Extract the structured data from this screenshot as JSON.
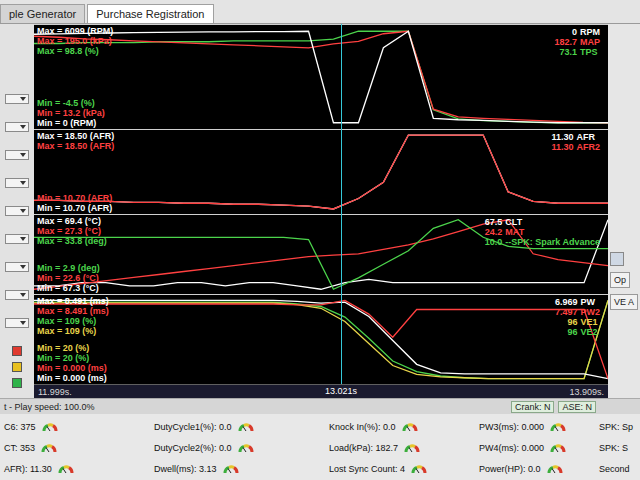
{
  "tabs": [
    {
      "label": "ple Generator",
      "selected": false
    },
    {
      "label": "Purchase Registration",
      "selected": true
    }
  ],
  "left_markers": [
    {
      "color": "#e03a2f"
    },
    {
      "color": "#e8c020"
    },
    {
      "color": "#2fb34a"
    }
  ],
  "right_buttons": [
    "Op",
    "VE A"
  ],
  "chart": {
    "start": "11.999s.",
    "cursor": "13.021s",
    "end": "13.909s.",
    "cursor_position": 0.535,
    "panels": [
      {
        "max_labels": [
          {
            "text": "Max = 6099 (RPM)",
            "color": "#ffffff"
          },
          {
            "text": "Max = 195.0 (kPa)",
            "color": "#ff4040"
          },
          {
            "text": "Max = 98.8 (%)",
            "color": "#4cd44c"
          }
        ],
        "min_labels": [
          {
            "text": "Min = -4.5 (%)",
            "color": "#4cd44c"
          },
          {
            "text": "Min = 13.2 (kPa)",
            "color": "#ff4040"
          },
          {
            "text": "Min = 0 (RPM)",
            "color": "#ffffff"
          }
        ],
        "readings": [
          {
            "value": "0",
            "name": "RPM",
            "color": "#ffffff"
          },
          {
            "value": "182.7",
            "name": "MAP",
            "color": "#ff4040"
          },
          {
            "value": "73.1",
            "name": "TPS",
            "color": "#4cd44c"
          }
        ],
        "series": [
          {
            "name": "TPS",
            "color": "#4cd44c",
            "values": [
              85,
              85,
              86,
              86,
              86,
              87,
              87,
              87,
              88,
              88,
              88,
              88,
              90,
              98.8,
              98.8,
              98.8,
              10,
              0,
              -2,
              -3,
              -4,
              -4.5,
              -4.5,
              -4.5
            ]
          },
          {
            "name": "MAP",
            "color": "#ff4040",
            "values": [
              185,
              183,
              180,
              178,
              176,
              174,
              172,
              170,
              168,
              166,
              164,
              162,
              170,
              175,
              190,
              195,
              40,
              25,
              22,
              20,
              18,
              16,
              14,
              13.2
            ]
          },
          {
            "name": "RPM",
            "color": "#ffffff",
            "values": [
              5900,
              5920,
              5950,
              5980,
              6000,
              6020,
              6040,
              6050,
              6060,
              6070,
              6080,
              6099,
              0,
              0,
              5000,
              6099,
              300,
              200,
              150,
              100,
              50,
              0,
              0,
              0
            ]
          }
        ]
      },
      {
        "max_labels": [
          {
            "text": "Max = 18.50 (AFR)",
            "color": "#ffffff"
          },
          {
            "text": "Max = 18.50 (AFR)",
            "color": "#ff4040"
          }
        ],
        "min_labels": [
          {
            "text": "Min = 10.70 (AFR)",
            "color": "#ff4040"
          },
          {
            "text": "Min = 10.70 (AFR)",
            "color": "#ffffff"
          }
        ],
        "readings": [
          {
            "value": "11.30",
            "name": "AFR",
            "color": "#ffffff"
          },
          {
            "value": "11.30",
            "name": "AFR2",
            "color": "#ff4040"
          }
        ],
        "series": [
          {
            "name": "AFR",
            "color": "#ffffff",
            "values": [
              11.6,
              11.6,
              11.5,
              11.5,
              11.4,
              11.4,
              11.3,
              11.3,
              11.2,
              11.2,
              11.1,
              11.0,
              10.7,
              11.8,
              13.5,
              18.5,
              18.5,
              18.5,
              18.5,
              12.5,
              11.5,
              11.3,
              11.3,
              11.3
            ]
          },
          {
            "name": "AFR2",
            "color": "#ff4040",
            "values": [
              11.6,
              11.6,
              11.5,
              11.5,
              11.4,
              11.4,
              11.3,
              11.3,
              11.2,
              11.2,
              11.1,
              11.0,
              10.7,
              11.8,
              13.5,
              18.5,
              18.5,
              18.5,
              18.5,
              12.5,
              11.5,
              11.3,
              11.3,
              11.3
            ]
          }
        ]
      },
      {
        "max_labels": [
          {
            "text": "Max = 69.4 (°C)",
            "color": "#ffffff"
          },
          {
            "text": "Max = 27.3 (°C)",
            "color": "#ff4040"
          },
          {
            "text": "Max = 33.8 (deg)",
            "color": "#4cd44c"
          }
        ],
        "min_labels": [
          {
            "text": "Min = 2.9 (deg)",
            "color": "#4cd44c"
          },
          {
            "text": "Min = 22.6 (°C)",
            "color": "#ff4040"
          },
          {
            "text": "Min = 67.3 (°C)",
            "color": "#ffffff"
          }
        ],
        "readings": [
          {
            "value": "67.5",
            "name": "CLT",
            "color": "#ffffff"
          },
          {
            "value": "24.2",
            "name": "MAT",
            "color": "#ff4040"
          },
          {
            "value": "10.0",
            "name": "--SPK: Spark Advance",
            "color": "#4cd44c"
          }
        ],
        "series": [
          {
            "name": "CLT",
            "color": "#ffffff",
            "values": [
              67.4,
              67.4,
              67.5,
              67.5,
              67.4,
              67.4,
              67.5,
              67.5,
              67.4,
              67.5,
              67.5,
              67.4,
              67.3,
              67.5,
              67.6,
              67.5,
              67.5,
              67.5,
              67.5,
              67.5,
              67.5,
              67.5,
              67.5,
              67.5,
              69.4
            ]
          },
          {
            "name": "MAT",
            "color": "#ff4040",
            "values": [
              22.6,
              22.8,
              23.0,
              23.2,
              23.4,
              23.6,
              23.8,
              24.0,
              24.2,
              24.4,
              24.6,
              24.8,
              24.9,
              25.0,
              25.3,
              25.6,
              26.0,
              26.5,
              27.0,
              27.3,
              25.0,
              24.6,
              24.4,
              24.2
            ]
          },
          {
            "name": "SPK",
            "color": "#4cd44c",
            "values": [
              26,
              26,
              26,
              26,
              26,
              26,
              26,
              26,
              26,
              26,
              26,
              25,
              2.9,
              8,
              14,
              20,
              30,
              33.8,
              26,
              22,
              21,
              21,
              21,
              21
            ]
          }
        ]
      },
      {
        "max_labels": [
          {
            "text": "Max = 8.491 (ms)",
            "color": "#ffffff"
          },
          {
            "text": "Max = 8.491 (ms)",
            "color": "#ff4040"
          },
          {
            "text": "Max = 109 (%)",
            "color": "#4cd44c"
          },
          {
            "text": "Max = 109 (%)",
            "color": "#e8d44a"
          }
        ],
        "min_labels": [
          {
            "text": "Min = 20 (%)",
            "color": "#e8d44a"
          },
          {
            "text": "Min = 20 (%)",
            "color": "#4cd44c"
          },
          {
            "text": "Min = 0.000 (ms)",
            "color": "#ff4040"
          },
          {
            "text": "Min = 0.000 (ms)",
            "color": "#ffffff"
          }
        ],
        "readings": [
          {
            "value": "6.969",
            "name": "PW",
            "color": "#ffffff"
          },
          {
            "value": "7.497",
            "name": "PW2",
            "color": "#ff4040"
          },
          {
            "value": "96",
            "name": "VE1",
            "color": "#e8d44a"
          },
          {
            "value": "96",
            "name": "VE2",
            "color": "#4cd44c"
          }
        ],
        "series": [
          {
            "name": "VE2",
            "color": "#4cd44c",
            "values": [
              107,
              107,
              107,
              107,
              107,
              107,
              107,
              107,
              107,
              107,
              107,
              105,
              102,
              90,
              66,
              40,
              28,
              23,
              21,
              20,
              20,
              20,
              20,
              20,
              109
            ]
          },
          {
            "name": "VE1",
            "color": "#e8d44a",
            "values": [
              106,
              106,
              106,
              106,
              106,
              106,
              106,
              106,
              106,
              106,
              106,
              104,
              100,
              85,
              60,
              35,
              25,
              22,
              21,
              20,
              20,
              20,
              20,
              20,
              109
            ]
          },
          {
            "name": "PW",
            "color": "#ffffff",
            "values": [
              8.2,
              8.2,
              8.2,
              8.2,
              8.2,
              8.2,
              8.2,
              8.2,
              8.2,
              8.2,
              8.2,
              8.1,
              7.9,
              8.0,
              6.5,
              4.0,
              1.5,
              0.6,
              0.5,
              0.5,
              0.5,
              0.5,
              0.5,
              0.5,
              0
            ]
          },
          {
            "name": "PW2",
            "color": "#ff4040",
            "values": [
              8.1,
              8.1,
              8.1,
              8.1,
              8.1,
              8.1,
              8.1,
              8.1,
              8.1,
              8.1,
              8.1,
              8.0,
              8.0,
              8.491,
              7.0,
              4.5,
              7.497,
              7.497,
              7.497,
              7.497,
              7.497,
              7.497,
              7.497,
              7.497,
              0
            ]
          }
        ]
      }
    ]
  },
  "play_speed": "t - Play speed: 100.0%",
  "flags": [
    {
      "label": "Crank: N",
      "on": false
    },
    {
      "label": "ASE: N",
      "on": false
    }
  ],
  "gauges": [
    [
      "C6: 375",
      "DutyCycle1(%): 0.0",
      "Knock In(%): 0.0",
      "PW3(ms): 0.000",
      "SPK: Sp"
    ],
    [
      "CT: 353",
      "DutyCycle2(%): 0.0",
      "Load(kPa): 182.7",
      "PW4(ms): 0.000",
      "SPK: S"
    ],
    [
      "AFR): 11.30",
      "Dwell(ms): 3.13",
      "Lost Sync Count: 4",
      "Power(HP): 0.0",
      "Second"
    ]
  ]
}
